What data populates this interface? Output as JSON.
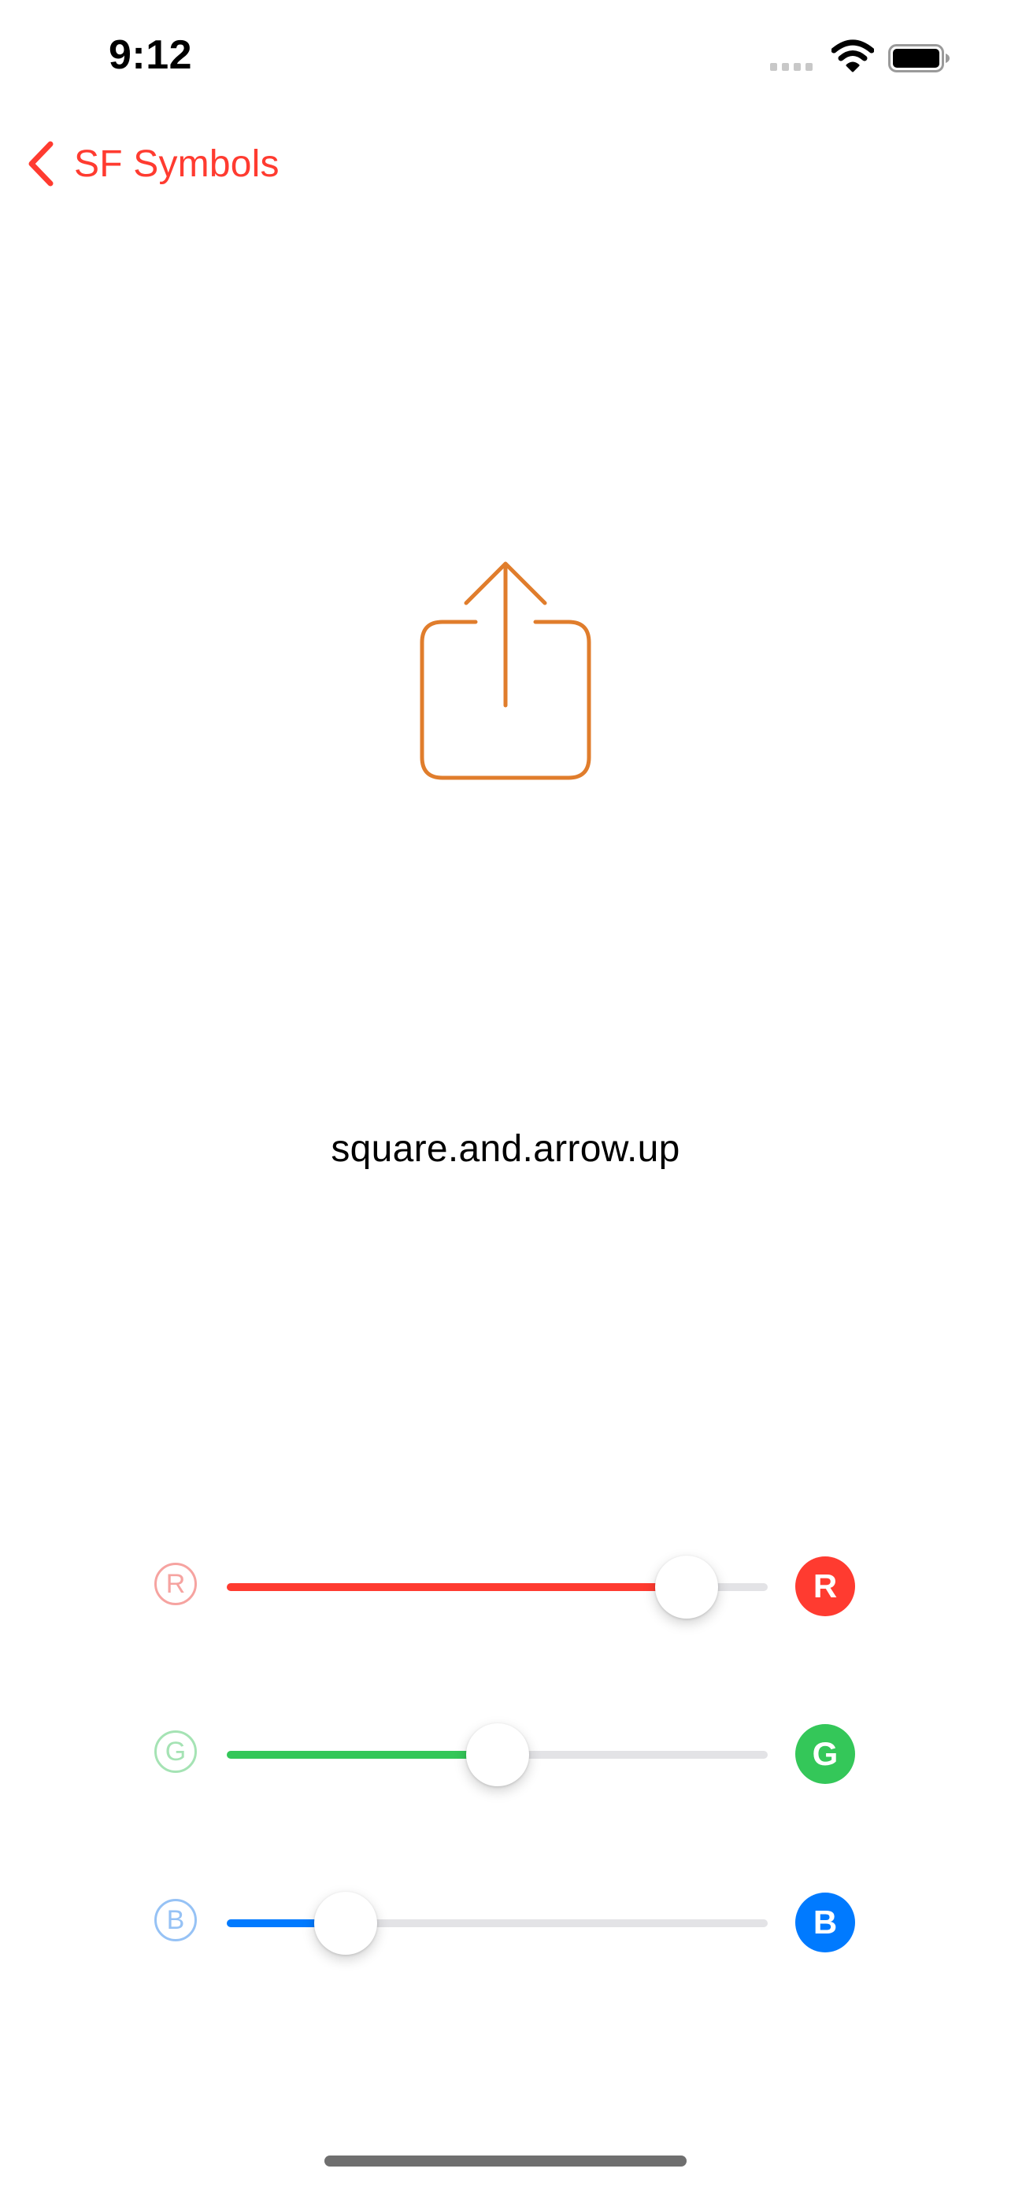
{
  "status_bar": {
    "time": "9:12"
  },
  "nav": {
    "back_label": "SF Symbols"
  },
  "symbol": {
    "name": "square.and.arrow.up",
    "icon": "square-and-arrow-up-icon",
    "color": "#E07D2C"
  },
  "sliders": [
    {
      "letter": "R",
      "value": 0.85,
      "accent": "#FF3B30",
      "outline": "#F6A3A0"
    },
    {
      "letter": "G",
      "value": 0.5,
      "accent": "#34C759",
      "outline": "#A5E3B4"
    },
    {
      "letter": "B",
      "value": 0.22,
      "accent": "#007AFF",
      "outline": "#96C2F5"
    }
  ],
  "colors": {
    "tint": "#FF3B30",
    "track": "#E3E3E6"
  }
}
